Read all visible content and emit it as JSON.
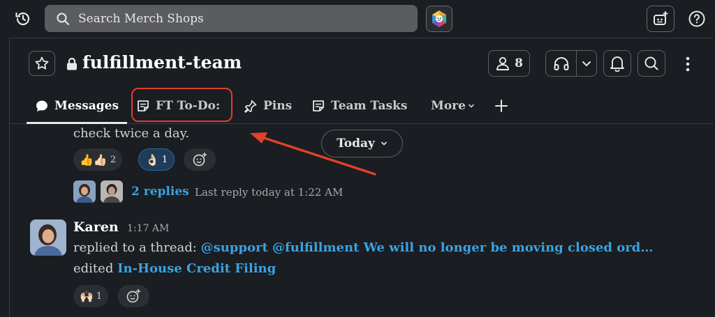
{
  "search": {
    "placeholder": "Search Merch Shops"
  },
  "channel": {
    "name": "fulfillment-team",
    "member_count": "8"
  },
  "tabs": [
    {
      "label": "Messages"
    },
    {
      "label": "FT To-Do:"
    },
    {
      "label": "Pins"
    },
    {
      "label": "Team Tasks"
    },
    {
      "label": "More"
    }
  ],
  "date_divider": "Today",
  "thread": {
    "message_tail": "check twice a day.",
    "reactions": [
      {
        "emoji": "👍👍🏻",
        "count": "2"
      },
      {
        "emoji": "👌🏻",
        "count": "1"
      }
    ],
    "replies_label": "2 replies",
    "last_reply": "Last reply today at 1:22 AM"
  },
  "message": {
    "author": "Karen",
    "time": "1:17 AM",
    "line1_prefix": "replied to a thread: ",
    "line1_link": "@support @fulfillment We will no longer be moving closed ord…",
    "line2_prefix": "edited ",
    "line2_link": "In-House Credit Filing",
    "reaction": {
      "emoji": "🙌🏻",
      "count": "1"
    }
  },
  "colors": {
    "accent_link": "#3aa3e3",
    "annotation_red": "#e0412a",
    "background": "#1a1d21"
  }
}
